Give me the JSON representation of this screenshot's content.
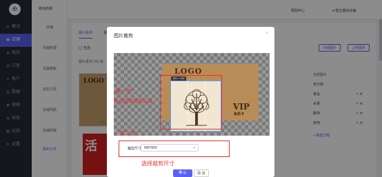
{
  "sidebar": {
    "brand": "小",
    "items": [
      {
        "label": "概况",
        "icon": "dashboard-icon"
      },
      {
        "label": "店铺",
        "icon": "store-icon"
      },
      {
        "label": "商品",
        "icon": "goods-icon"
      },
      {
        "label": "订单",
        "icon": "order-icon"
      },
      {
        "label": "客户",
        "icon": "customer-icon"
      },
      {
        "label": "数据",
        "icon": "data-icon"
      },
      {
        "label": "营销",
        "icon": "marketing-icon"
      },
      {
        "label": "财务",
        "icon": "finance-icon"
      },
      {
        "label": "应用",
        "icon": "apps-icon"
      },
      {
        "label": "设置",
        "icon": "settings-icon"
      }
    ]
  },
  "subnav": {
    "title": "移动商城",
    "items": [
      "店铺",
      "页面管理",
      "页面模板",
      "自定义页",
      "店铺导航",
      "店铺风格",
      "我的文件"
    ]
  },
  "topbar": {
    "help": "帮助中心",
    "user": "杨正鑫的店铺"
  },
  "main": {
    "tabs": [
      "图片素材",
      "视频"
    ],
    "check_all": "全选",
    "count_text": "图片素材 332 张",
    "btn_group": "分组图片",
    "btn_upload": "上传图片",
    "thumb_logo": "LOGO",
    "thumb_label": "549...",
    "red_thumb_text": "活"
  },
  "groups": {
    "header": "全部图片",
    "items": [
      "未分组",
      "食品",
      "水果",
      "服饰",
      "家电"
    ],
    "ops": "✎ ✖",
    "add": "+ 新建分组"
  },
  "modal": {
    "title": "图片裁剪",
    "close": "×",
    "card_logo": "LOGO",
    "card_vip": "VIP",
    "card_sub": "会员卡",
    "crop_size_badge": "152 × 152",
    "annotation_1": "第一步：",
    "annotation_2": "拖动选择裁剪区域",
    "annotation_3": "第二步：",
    "form_label": "裁剪尺寸：",
    "select_value": "800*800",
    "select_arrow": "▾",
    "hint": "选择裁剪尺寸",
    "confirm": "确 认",
    "cancel": "取 消"
  },
  "colors": {
    "accent": "#5b62f0",
    "annotation": "#e53030",
    "sidebar": "#272a3a"
  }
}
